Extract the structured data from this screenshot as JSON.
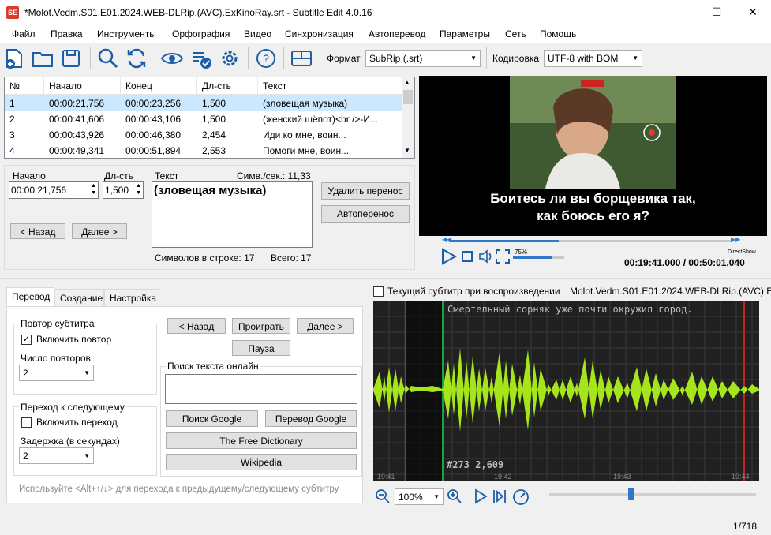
{
  "window": {
    "title": "*Molot.Vedm.S01.E01.2024.WEB-DLRip.(AVC).ExKinoRay.srt - Subtitle Edit 4.0.16",
    "app_icon": "SE"
  },
  "menu": [
    "Файл",
    "Правка",
    "Инструменты",
    "Орфография",
    "Видео",
    "Синхронизация",
    "Автоперевод",
    "Параметры",
    "Сеть",
    "Помощь"
  ],
  "toolbar": {
    "format_label": "Формат",
    "format_value": "SubRip (.srt)",
    "encoding_label": "Кодировка",
    "encoding_value": "UTF-8 with BOM"
  },
  "grid": {
    "headers": [
      "№",
      "Начало",
      "Конец",
      "Дл-сть",
      "Текст"
    ],
    "rows": [
      {
        "n": "1",
        "start": "00:00:21,756",
        "end": "00:00:23,256",
        "dur": "1,500",
        "text": "(зловещая музыка)"
      },
      {
        "n": "2",
        "start": "00:00:41,606",
        "end": "00:00:43,106",
        "dur": "1,500",
        "text": "(женский шёпот)<br />-И..."
      },
      {
        "n": "3",
        "start": "00:00:43,926",
        "end": "00:00:46,380",
        "dur": "2,454",
        "text": "Иди ко мне, воин..."
      },
      {
        "n": "4",
        "start": "00:00:49,341",
        "end": "00:00:51,894",
        "dur": "2,553",
        "text": "Помоги мне, воин..."
      }
    ]
  },
  "editor": {
    "start_label": "Начало",
    "start_value": "00:00:21,756",
    "dur_label": "Дл-сть",
    "dur_value": "1,500",
    "text_label": "Текст",
    "cps_label": "Симв./сек.: 11,33",
    "text_value": "(зловещая музыка)",
    "remove_break": "Удалить перенос",
    "auto_break": "Автоперенос",
    "prev": "< Назад",
    "next": "Далее >",
    "line_chars": "Символов в строке: 17",
    "total": "Всего: 17"
  },
  "video": {
    "subtitle_line1": "Боитесь ли вы борщевика так,",
    "subtitle_line2": "как боюсь его я?",
    "volume": "75%",
    "volume_level": 0.75,
    "progress": 0.387,
    "renderer": "DirectShow",
    "time": "00:19:41.000 / 00:50:01.040"
  },
  "tabs": [
    "Перевод",
    "Создание",
    "Настройка"
  ],
  "translate_tab": {
    "repeat_group": "Повтор субтитра",
    "enable_repeat": "Включить повтор",
    "repeat_count_label": "Число повторов",
    "repeat_count": "2",
    "next_group": "Переход к следующему",
    "enable_next": "Включить переход",
    "delay_label": "Задержка (в секундах)",
    "delay": "2",
    "prev": "< Назад",
    "play": "Проиграть",
    "next": "Далее >",
    "pause": "Пауза",
    "search_group": "Поиск текста онлайн",
    "google_search": "Поиск Google",
    "google_translate": "Перевод Google",
    "free_dictionary": "The Free Dictionary",
    "wikipedia": "Wikipedia",
    "hint": "Используйте <Alt+↑/↓> для перехода к предыдущему/следующему субтитру"
  },
  "waveform": {
    "current_sub_label": "Текущий субтитр при воспроизведении",
    "file_name": "Molot.Vedm.S01.E01.2024.WEB-DLRip.(AVC).E",
    "overlay_text": "Смертельный сорняк уже почти окружил город.",
    "marker": "#273  2,609",
    "times": [
      "19:41",
      "19:42",
      "19:43",
      "19:44"
    ],
    "zoom": "100%"
  },
  "status": "1/718"
}
